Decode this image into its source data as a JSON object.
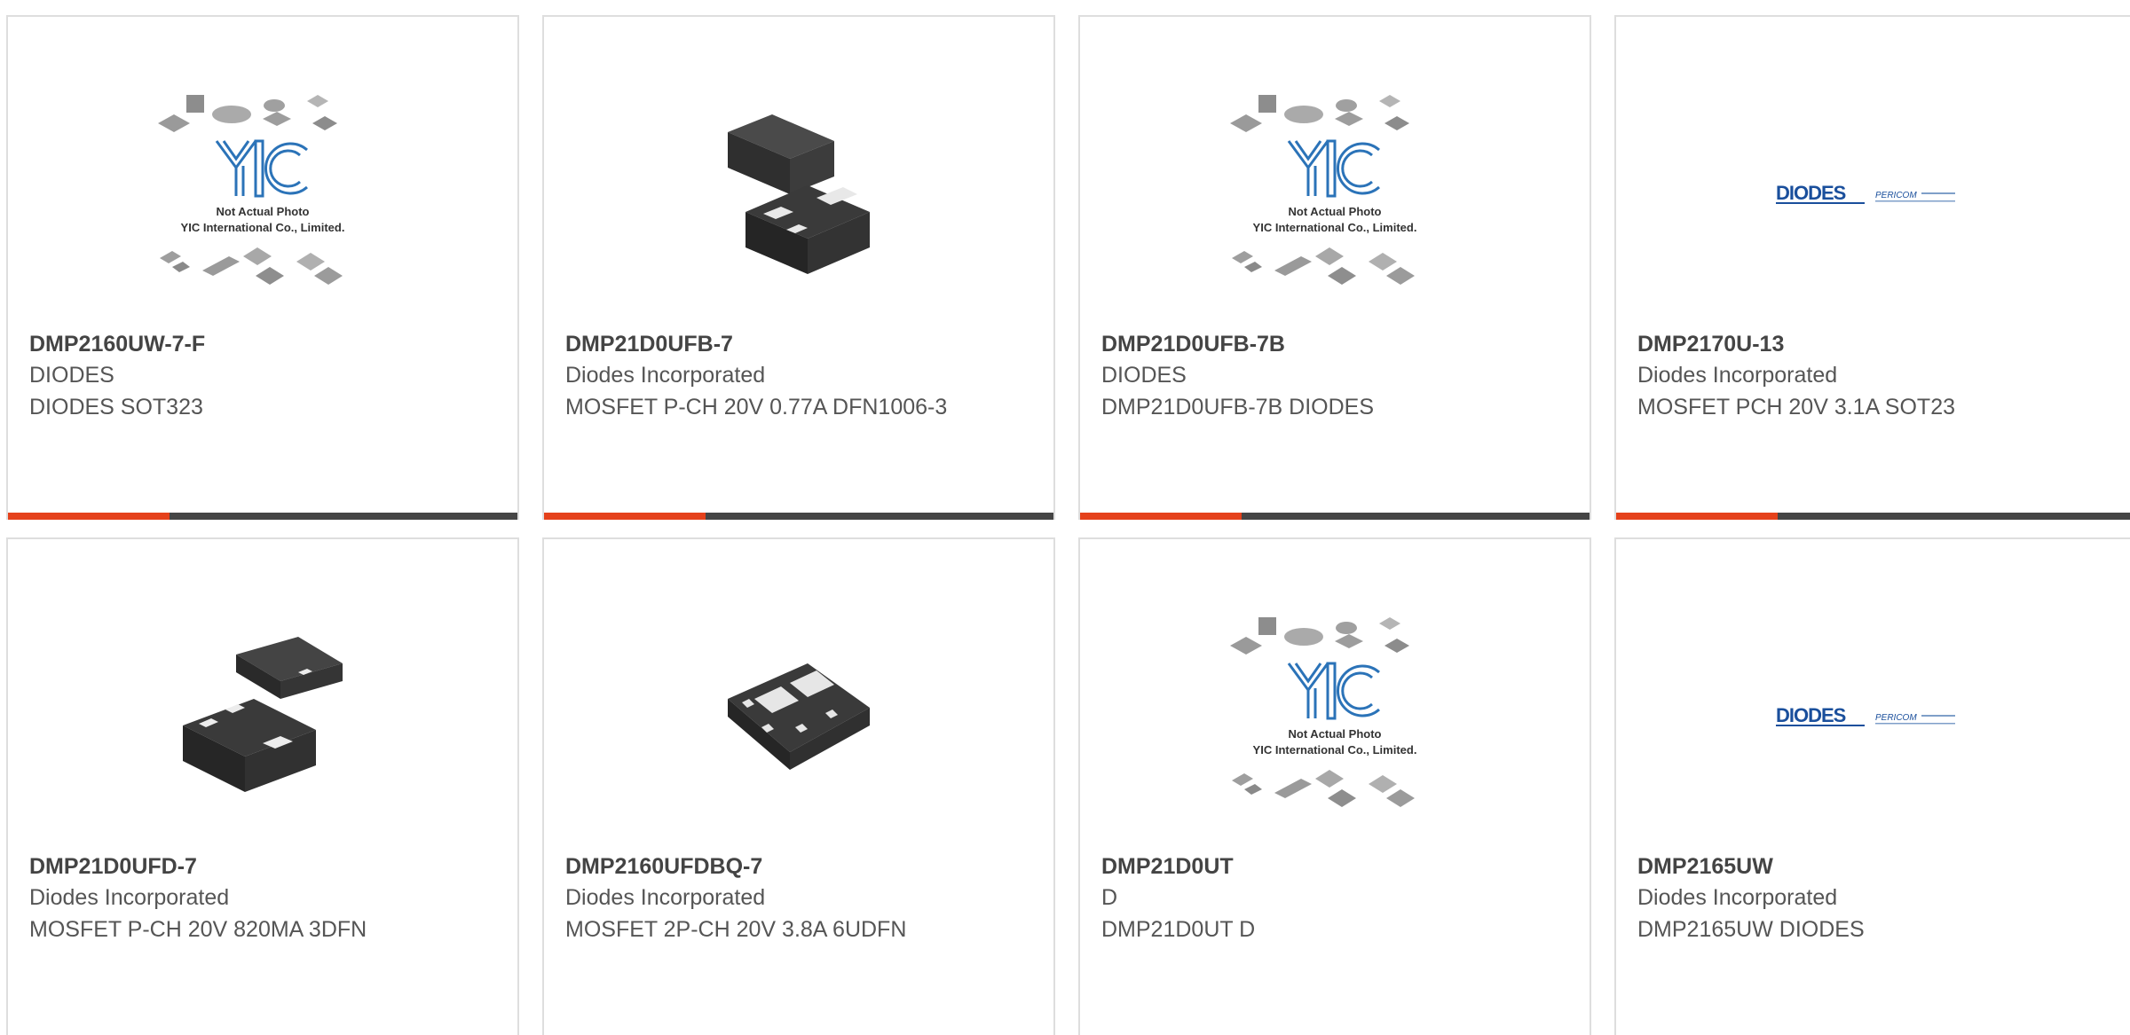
{
  "products": [
    {
      "part_number": "DMP2160UW-7-F",
      "manufacturer": "DIODES",
      "description": "DIODES SOT323",
      "image": "yic",
      "image_caption_1": "Not Actual Photo",
      "image_caption_2": "YIC International Co., Limited."
    },
    {
      "part_number": "DMP21D0UFB-7",
      "manufacturer": "Diodes Incorporated",
      "description": "MOSFET P-CH 20V 0.77A DFN1006-3",
      "image": "dfn-package"
    },
    {
      "part_number": "DMP21D0UFB-7B",
      "manufacturer": "DIODES",
      "description": "DMP21D0UFB-7B DIODES",
      "image": "yic",
      "image_caption_1": "Not Actual Photo",
      "image_caption_2": "YIC International Co., Limited."
    },
    {
      "part_number": "DMP2170U-13",
      "manufacturer": "Diodes Incorporated",
      "description": "MOSFET PCH 20V 3.1A SOT23",
      "image": "diodes-logo",
      "logo_text": "DIODES",
      "logo_subtext": "PERICOM"
    },
    {
      "part_number": "DMP21D0UFD-7",
      "manufacturer": "Diodes Incorporated",
      "description": "MOSFET P-CH 20V 820MA 3DFN",
      "image": "dfn3-package"
    },
    {
      "part_number": "DMP2160UFDBQ-7",
      "manufacturer": "Diodes Incorporated",
      "description": "MOSFET 2P-CH 20V 3.8A 6UDFN",
      "image": "udfn6-package"
    },
    {
      "part_number": "DMP21D0UT",
      "manufacturer": "D",
      "description": "DMP21D0UT D",
      "image": "yic",
      "image_caption_1": "Not Actual Photo",
      "image_caption_2": "YIC International Co., Limited."
    },
    {
      "part_number": "DMP2165UW",
      "manufacturer": "Diodes Incorporated",
      "description": "DMP2165UW DIODES",
      "image": "diodes-logo",
      "logo_text": "DIODES",
      "logo_subtext": "PERICOM"
    }
  ],
  "colors": {
    "accent": "#e5411b",
    "bar": "#454545",
    "border": "#dedede",
    "logo_blue": "#1a4f9c"
  }
}
